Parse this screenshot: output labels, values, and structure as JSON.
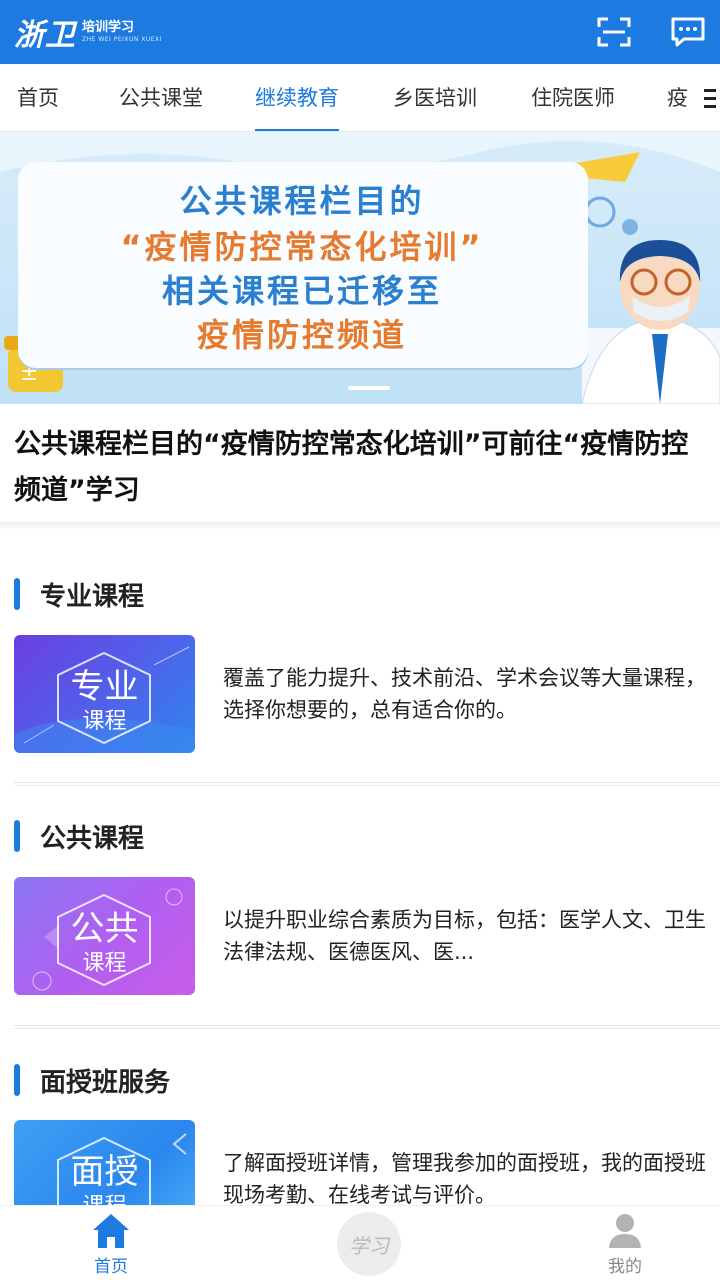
{
  "header": {
    "logo_main": "浙卫",
    "logo_sub": "培训学习",
    "logo_en": "ZHE WEI PEIXUN XUEXI",
    "scan_icon": "scan-icon",
    "message_icon": "message-icon"
  },
  "tabs": {
    "items": [
      {
        "label": "首页",
        "active": false
      },
      {
        "label": "公共课堂",
        "active": false
      },
      {
        "label": "继续教育",
        "active": true
      },
      {
        "label": "乡医培训",
        "active": false
      },
      {
        "label": "住院医师",
        "active": false
      },
      {
        "label": "疫",
        "active": false
      }
    ],
    "more_icon": "menu-icon"
  },
  "banner": {
    "line1": "公共课程栏目的",
    "line2": "“疫情防控常态化培训”",
    "line3": "相关课程已迁移至",
    "line4": "疫情防控频道"
  },
  "caption": "公共课程栏目的“疫情防控常态化培训”可前往“疫情防控频道”学习",
  "sections": [
    {
      "title": "专业课程",
      "thumb_line1": "专业",
      "thumb_line2": "课程",
      "description": "覆盖了能力提升、技术前沿、学术会议等大量课程，选择你想要的，总有适合你的。"
    },
    {
      "title": "公共课程",
      "thumb_line1": "公共",
      "thumb_line2": "课程",
      "description": "以提升职业综合素质为目标，包括：医学人文、卫生法律法规、医德医风、医..."
    },
    {
      "title": "面授班服务",
      "thumb_line1": "面授",
      "thumb_line2": "课程",
      "description": "了解面授班详情，管理我参加的面授班，我的面授班现场考勤、在线考试与评价。"
    }
  ],
  "bottom_nav": {
    "home_label": "首页",
    "study_glyph": "学习",
    "mine_label": "我的"
  },
  "colors": {
    "primary": "#1d7ae0",
    "banner_blue": "#2b7fd1",
    "banner_orange": "#e67a2e"
  }
}
